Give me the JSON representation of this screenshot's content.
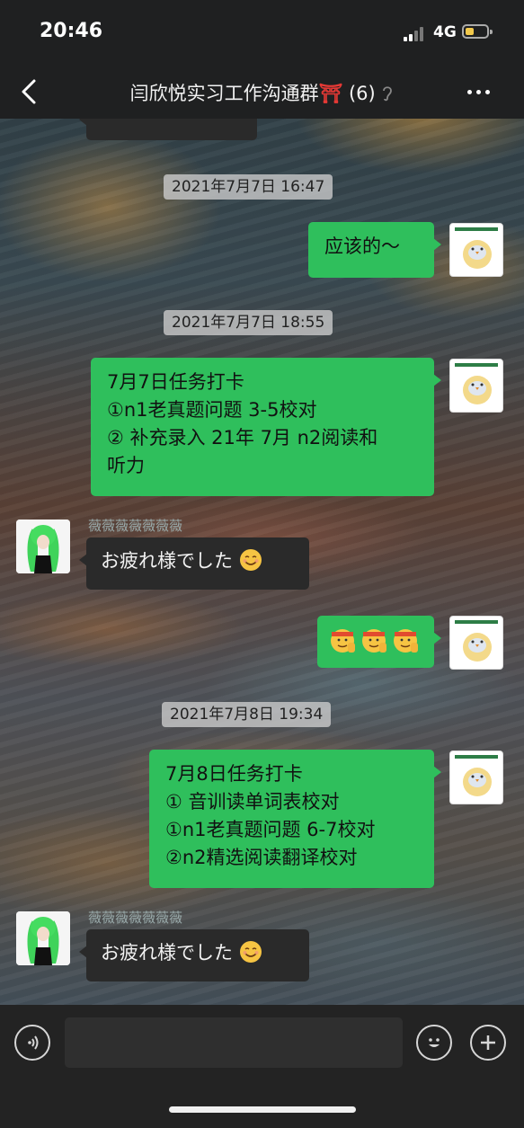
{
  "status_bar": {
    "time": "20:46",
    "network": "4G"
  },
  "header": {
    "title": "闫欣悦实习工作沟通群",
    "torii": "⛩",
    "member_count": "(6)",
    "mute_icon": "ear-icon"
  },
  "messages": [
    {
      "type": "partial_top",
      "sender": "other"
    },
    {
      "type": "timestamp",
      "text": "2021年7月7日 16:47"
    },
    {
      "type": "message",
      "sender": "me",
      "lines": [
        "应该的～"
      ]
    },
    {
      "type": "timestamp",
      "text": "2021年7月7日 18:55"
    },
    {
      "type": "message",
      "sender": "me",
      "lines": [
        "7月7日任务打卡",
        "①n1老真题问题 3-5校对",
        "② 补充录入 21年 7月 n2阅读和",
        "听力"
      ]
    },
    {
      "type": "message",
      "sender": "other",
      "name": "薇薇薇薇薇薇薇",
      "text": "お疲れ様でした",
      "emoji": "smiling-face-emoji"
    },
    {
      "type": "message",
      "sender": "me",
      "emoji": "saluting-face-emoji x3"
    },
    {
      "type": "timestamp",
      "text": "2021年7月8日 19:34"
    },
    {
      "type": "message",
      "sender": "me",
      "lines": [
        "7月8日任务打卡",
        "① 音训读单词表校对",
        "①n1老真题问题 6-7校对",
        "②n2精选阅读翻译校对"
      ]
    },
    {
      "type": "message",
      "sender": "other",
      "name": "薇薇薇薇薇薇薇",
      "text": "お疲れ様でした",
      "emoji": "smiling-face-emoji"
    }
  ],
  "input_bar": {
    "voice_icon": "voice-icon",
    "emoji_icon": "emoji-icon",
    "plus_icon": "plus-icon"
  },
  "colors": {
    "my_bubble": "#2fbf5c",
    "other_bubble": "#2a2a2a",
    "header_bg": "#1f2021"
  }
}
